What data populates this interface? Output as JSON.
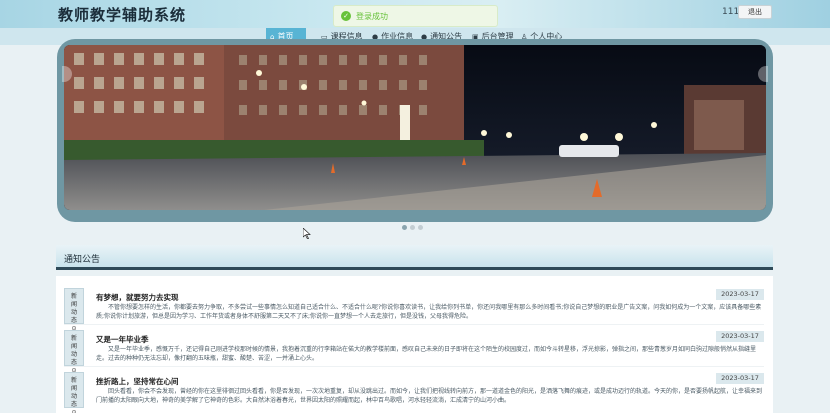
{
  "header": {
    "site_title": "教师教学辅助系统",
    "user_name": "111",
    "logout_label": "退出"
  },
  "toast": {
    "message": "登录成功"
  },
  "nav": {
    "items": [
      {
        "label": "首页",
        "icon": "home-icon",
        "active": true
      },
      {
        "label": "课程信息",
        "icon": "book-icon",
        "active": false
      },
      {
        "label": "作业信息",
        "icon": "info-icon",
        "active": false
      },
      {
        "label": "通知公告",
        "icon": "info-icon",
        "active": false
      },
      {
        "label": "后台管理",
        "icon": "briefcase-icon",
        "active": false
      },
      {
        "label": "个人中心",
        "icon": "user-icon",
        "active": false
      }
    ]
  },
  "carousel": {
    "dot_count": 3,
    "active_dot": 0
  },
  "notices": {
    "section_title": "通知公告",
    "badge_label": "新闻动态",
    "items": [
      {
        "title": "有梦想，就要努力去实现",
        "date": "2023-03-17",
        "body": "不管你想要怎样的生活，你都要去努力争取，不多尝试一些事情怎么知道自己适合什么、不适合什么呢?你说你喜欢读书，让我给你列书单，你还问我哪里有那么多时间看书;你说自己梦想的职业是广告文案，问我如何成为一个文案，应该具备哪些素质;你说你计划旅游，但总是因为学习、工作年货或者身体不舒服第二天又不了床;你说你一直梦想一个人去走旅行，但是没钱，父母我得危险。"
      },
      {
        "title": "又是一年毕业季",
        "date": "2023-03-17",
        "body": "又是一年毕业季，感慨万千，还记得自己刚进学校那时候的情景，我抱着沉重的行李箱站在偌大的教学楼前面，感叹自己未来的日子即将在这个陌生的校园度过，而如今斗转星移，浮光掠影，弹指之间，那些青葱岁月如同白驹过隙般悄然从指缝里走。过去的种种仍无法忘却，像打翻的五味瓶，甜蜜、酸楚、苦涩，一并涌上心头。"
      },
      {
        "title": "挫折路上，坚持常在心间",
        "date": "2023-03-17",
        "body": "回头看看，你会不会发现，曾经的你在这里徘徊过回头看看，你是否发现，一次次地重复，却从没跳出过。而如今，让我们把视线转向前方，那一道道金色的阳光，是洒落飞舞的痕迹，或是成功迈行的轨道。今天的你，是否要扬帆起航，让幸福来到门前播的太阳眼向大地，神奇的美学解了它神奇的色彩。大自然沐浴着春光，世界因太阳的照耀而起，林中百鸟歌唱，河水轻轻流淌，汇成清宁的山河小曲。"
      }
    ]
  }
}
